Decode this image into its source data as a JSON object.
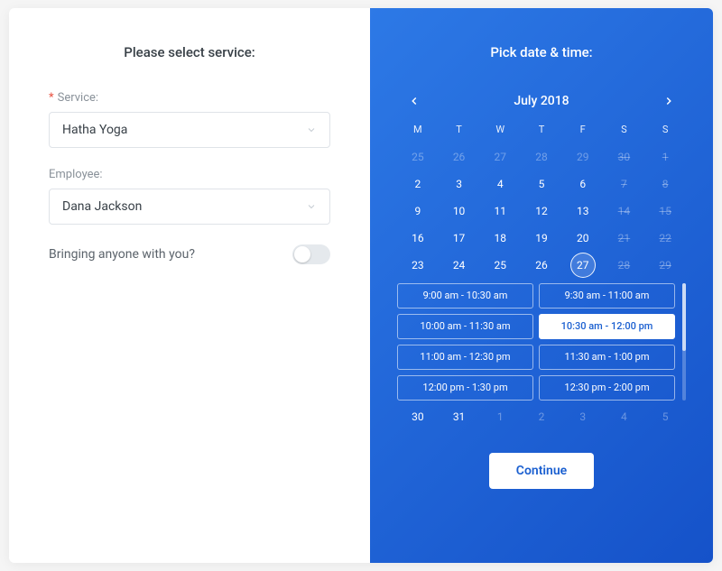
{
  "left": {
    "title": "Please select service:",
    "service_label": "Service:",
    "service_value": "Hatha Yoga",
    "employee_label": "Employee:",
    "employee_value": "Dana Jackson",
    "bringing_label": "Bringing anyone with you?",
    "bringing_on": false
  },
  "right": {
    "title": "Pick date & time:",
    "month_label": "July 2018",
    "weekdays": [
      "M",
      "T",
      "W",
      "T",
      "F",
      "S",
      "S"
    ],
    "weeks": [
      [
        {
          "n": "25",
          "cls": "other"
        },
        {
          "n": "26",
          "cls": "other"
        },
        {
          "n": "27",
          "cls": "other"
        },
        {
          "n": "28",
          "cls": "other"
        },
        {
          "n": "29",
          "cls": "other"
        },
        {
          "n": "30",
          "cls": "other strike"
        },
        {
          "n": "1",
          "cls": "strike"
        }
      ],
      [
        {
          "n": "2",
          "cls": ""
        },
        {
          "n": "3",
          "cls": ""
        },
        {
          "n": "4",
          "cls": ""
        },
        {
          "n": "5",
          "cls": ""
        },
        {
          "n": "6",
          "cls": ""
        },
        {
          "n": "7",
          "cls": "strike"
        },
        {
          "n": "8",
          "cls": "strike"
        }
      ],
      [
        {
          "n": "9",
          "cls": ""
        },
        {
          "n": "10",
          "cls": ""
        },
        {
          "n": "11",
          "cls": ""
        },
        {
          "n": "12",
          "cls": ""
        },
        {
          "n": "13",
          "cls": ""
        },
        {
          "n": "14",
          "cls": "strike"
        },
        {
          "n": "15",
          "cls": "strike"
        }
      ],
      [
        {
          "n": "16",
          "cls": ""
        },
        {
          "n": "17",
          "cls": ""
        },
        {
          "n": "18",
          "cls": ""
        },
        {
          "n": "19",
          "cls": ""
        },
        {
          "n": "20",
          "cls": ""
        },
        {
          "n": "21",
          "cls": "strike"
        },
        {
          "n": "22",
          "cls": "strike"
        }
      ],
      [
        {
          "n": "23",
          "cls": ""
        },
        {
          "n": "24",
          "cls": ""
        },
        {
          "n": "25",
          "cls": ""
        },
        {
          "n": "26",
          "cls": ""
        },
        {
          "n": "27",
          "cls": "selected"
        },
        {
          "n": "28",
          "cls": "strike"
        },
        {
          "n": "29",
          "cls": "strike"
        }
      ]
    ],
    "slots": [
      {
        "t": "9:00 am - 10:30 am",
        "sel": false
      },
      {
        "t": "9:30 am - 11:00 am",
        "sel": false
      },
      {
        "t": "10:00 am - 11:30 am",
        "sel": false
      },
      {
        "t": "10:30 am - 12:00 pm",
        "sel": true
      },
      {
        "t": "11:00 am - 12:30 pm",
        "sel": false
      },
      {
        "t": "11:30 am - 1:00 pm",
        "sel": false
      },
      {
        "t": "12:00 pm - 1:30 pm",
        "sel": false
      },
      {
        "t": "12:30 pm - 2:00 pm",
        "sel": false
      }
    ],
    "last_week": [
      {
        "n": "30",
        "cls": ""
      },
      {
        "n": "31",
        "cls": ""
      },
      {
        "n": "1",
        "cls": "other"
      },
      {
        "n": "2",
        "cls": "other"
      },
      {
        "n": "3",
        "cls": "other"
      },
      {
        "n": "4",
        "cls": "other"
      },
      {
        "n": "5",
        "cls": "other"
      }
    ],
    "continue_label": "Continue"
  }
}
